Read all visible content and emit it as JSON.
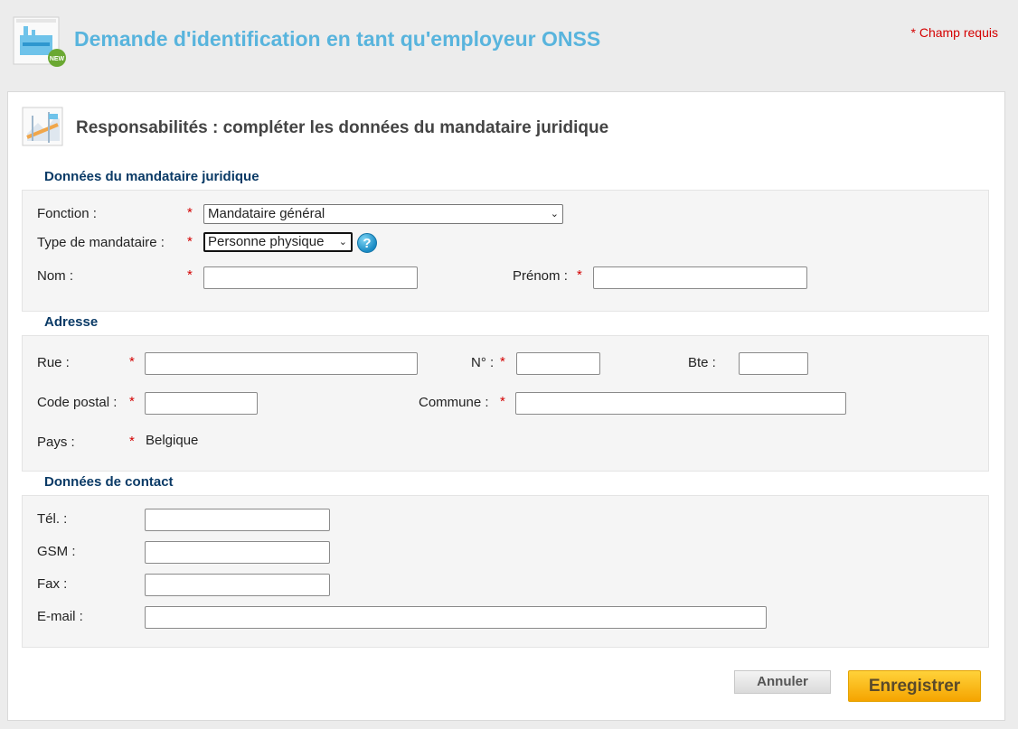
{
  "header": {
    "title": "Demande d'identification en tant qu'employeur ONSS",
    "required_note": "* Champ requis",
    "icon": "factory-new-icon",
    "badge": "NEW"
  },
  "section": {
    "title": "Responsabilités : compléter les données du mandataire juridique",
    "icon": "map-document-icon"
  },
  "mandataire": {
    "title": "Données du mandataire juridique",
    "fonction_label": "Fonction :",
    "fonction_value": "Mandataire général",
    "type_label": "Type de mandataire :",
    "type_value": "Personne physique",
    "nom_label": "Nom :",
    "prenom_label": "Prénom :",
    "required_mark": "*"
  },
  "adresse": {
    "title": "Adresse",
    "rue_label": "Rue :",
    "numero_label": "N° :",
    "bte_label": "Bte :",
    "code_postal_label": "Code postal :",
    "commune_label": "Commune :",
    "pays_label": "Pays :",
    "pays_value": "Belgique"
  },
  "contact": {
    "title": "Données de contact",
    "tel_label": "Tél. :",
    "gsm_label": "GSM :",
    "fax_label": "Fax :",
    "email_label": "E-mail :"
  },
  "actions": {
    "cancel_label": "Annuler",
    "save_label": "Enregistrer"
  },
  "colors": {
    "title_blue": "#58b4dd",
    "group_title": "#0a3a66",
    "required_red": "#d40000",
    "save_button": "#f5a400"
  }
}
